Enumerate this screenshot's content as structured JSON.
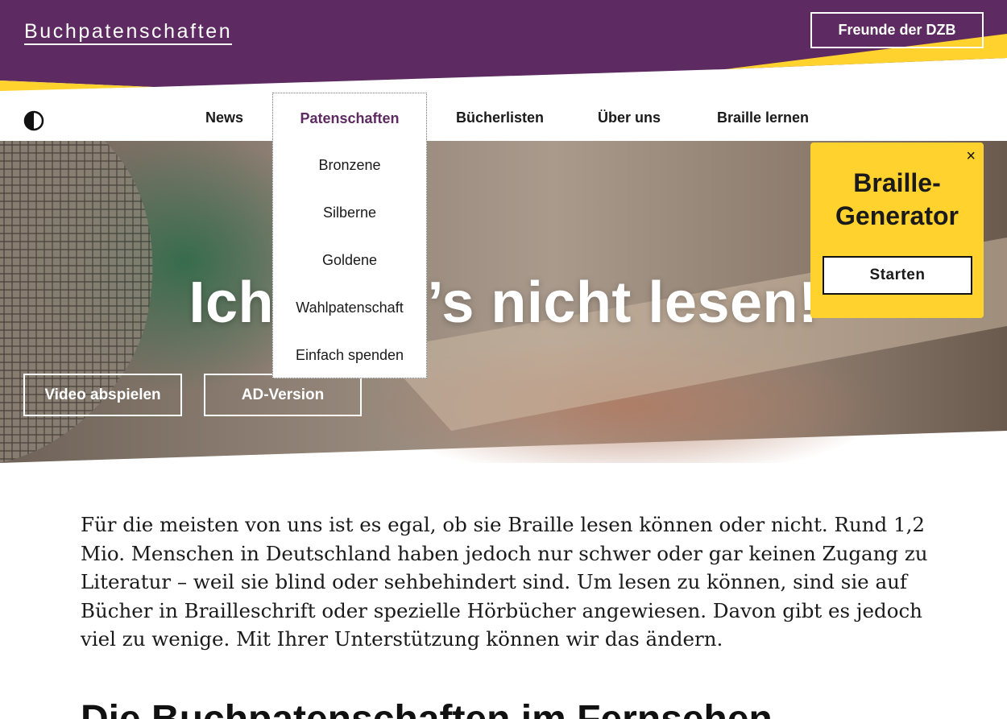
{
  "header": {
    "site_title": "Buchpatenschaften",
    "friends_button": "Freunde der DZB"
  },
  "colors": {
    "purple": "#5e2a62",
    "yellow": "#ffd22e"
  },
  "nav": {
    "contrast_icon": "half-circle-contrast-icon",
    "items": [
      {
        "label": "News"
      },
      {
        "label": "Patenschaften"
      },
      {
        "label": "Bücherlisten"
      },
      {
        "label": "Über uns"
      },
      {
        "label": "Braille lernen"
      }
    ],
    "dropdown": {
      "items": [
        "Bronzene",
        "Silberne",
        "Goldene",
        "Wahlpatenschaft",
        "Einfach spenden"
      ]
    }
  },
  "hero": {
    "title": "Ich kann’s nicht lesen!",
    "video_button": "Video abspielen",
    "ad_button": "AD-Version"
  },
  "braille_generator": {
    "close": "×",
    "title_line1": "Braille-",
    "title_line2": "Generator",
    "start_button": "Starten"
  },
  "intro_text": "Für die meisten von uns ist es egal, ob sie Braille lesen können oder nicht. Rund 1,2 Mio. Menschen in Deutschland haben jedoch nur schwer oder gar keinen Zugang zu Literatur – weil sie blind oder sehbehindert sind. Um lesen zu können, sind sie auf Bücher in Brailleschrift oder spezielle Hörbücher angewiesen. Davon gibt es jedoch viel zu wenige. Mit Ihrer Unterstützung können wir das ändern.",
  "section_heading": "Die Buchpatenschaften im Fernsehen"
}
